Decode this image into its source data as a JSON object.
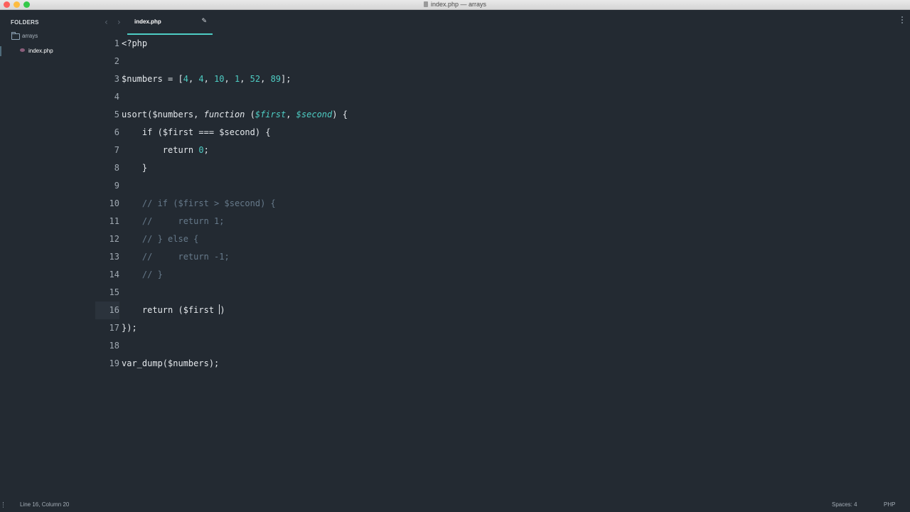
{
  "window": {
    "title": "index.php — arrays"
  },
  "sidebar": {
    "heading": "FOLDERS",
    "folder": "arrays",
    "file": "index.php"
  },
  "tabs": {
    "back": "‹",
    "forward": "›",
    "active_label": "index.php",
    "edit_glyph": "✎"
  },
  "editor": {
    "current_line": 16,
    "lines": [
      {
        "n": "1",
        "tokens": [
          [
            "t-tag",
            "<?php"
          ]
        ]
      },
      {
        "n": "2",
        "tokens": []
      },
      {
        "n": "3",
        "tokens": [
          [
            "t-var",
            "$numbers"
          ],
          [
            "t-punct",
            " = ["
          ],
          [
            "t-num",
            "4"
          ],
          [
            "t-punct",
            ", "
          ],
          [
            "t-num",
            "4"
          ],
          [
            "t-punct",
            ", "
          ],
          [
            "t-num",
            "10"
          ],
          [
            "t-punct",
            ", "
          ],
          [
            "t-num",
            "1"
          ],
          [
            "t-punct",
            ", "
          ],
          [
            "t-num",
            "52"
          ],
          [
            "t-punct",
            ", "
          ],
          [
            "t-num",
            "89"
          ],
          [
            "t-punct",
            "];"
          ]
        ]
      },
      {
        "n": "4",
        "tokens": []
      },
      {
        "n": "5",
        "tokens": [
          [
            "t-func",
            "usort"
          ],
          [
            "t-punct",
            "("
          ],
          [
            "t-var",
            "$numbers"
          ],
          [
            "t-punct",
            ", "
          ],
          [
            "t-kw t-italic",
            "function"
          ],
          [
            "t-punct",
            " ("
          ],
          [
            "t-param",
            "$first"
          ],
          [
            "t-punct",
            ", "
          ],
          [
            "t-param",
            "$second"
          ],
          [
            "t-punct",
            ") {"
          ]
        ]
      },
      {
        "n": "6",
        "tokens": [
          [
            "t-punct",
            "    "
          ],
          [
            "t-kw",
            "if"
          ],
          [
            "t-punct",
            " ("
          ],
          [
            "t-var",
            "$first"
          ],
          [
            "t-punct",
            " === "
          ],
          [
            "t-var",
            "$second"
          ],
          [
            "t-punct",
            ") {"
          ]
        ]
      },
      {
        "n": "7",
        "tokens": [
          [
            "t-punct",
            "        "
          ],
          [
            "t-kw",
            "return"
          ],
          [
            "t-punct",
            " "
          ],
          [
            "t-num",
            "0"
          ],
          [
            "t-punct",
            ";"
          ]
        ]
      },
      {
        "n": "8",
        "tokens": [
          [
            "t-punct",
            "    }"
          ]
        ]
      },
      {
        "n": "9",
        "tokens": []
      },
      {
        "n": "10",
        "tokens": [
          [
            "t-punct",
            "    "
          ],
          [
            "t-comment",
            "// if ($first > $second) {"
          ]
        ]
      },
      {
        "n": "11",
        "tokens": [
          [
            "t-punct",
            "    "
          ],
          [
            "t-comment",
            "//     return 1;"
          ]
        ]
      },
      {
        "n": "12",
        "tokens": [
          [
            "t-punct",
            "    "
          ],
          [
            "t-comment",
            "// } else {"
          ]
        ]
      },
      {
        "n": "13",
        "tokens": [
          [
            "t-punct",
            "    "
          ],
          [
            "t-comment",
            "//     return -1;"
          ]
        ]
      },
      {
        "n": "14",
        "tokens": [
          [
            "t-punct",
            "    "
          ],
          [
            "t-comment",
            "// }"
          ]
        ]
      },
      {
        "n": "15",
        "tokens": []
      },
      {
        "n": "16",
        "tokens": [
          [
            "t-punct",
            "    "
          ],
          [
            "t-kw",
            "return"
          ],
          [
            "t-punct",
            " ("
          ],
          [
            "t-var",
            "$first"
          ],
          [
            "t-punct",
            " "
          ],
          [
            "caret",
            ""
          ],
          [
            "t-punct",
            ")"
          ]
        ]
      },
      {
        "n": "17",
        "tokens": [
          [
            "t-punct",
            "});"
          ]
        ]
      },
      {
        "n": "18",
        "tokens": []
      },
      {
        "n": "19",
        "tokens": [
          [
            "t-func",
            "var_dump"
          ],
          [
            "t-punct",
            "("
          ],
          [
            "t-var",
            "$numbers"
          ],
          [
            "t-punct",
            ");"
          ]
        ]
      }
    ]
  },
  "status": {
    "position": "Line 16, Column 20",
    "spaces": "Spaces: 4",
    "syntax": "PHP"
  },
  "colors": {
    "background": "#232a32",
    "accent": "#4ecdc4",
    "comment": "#66798a"
  }
}
